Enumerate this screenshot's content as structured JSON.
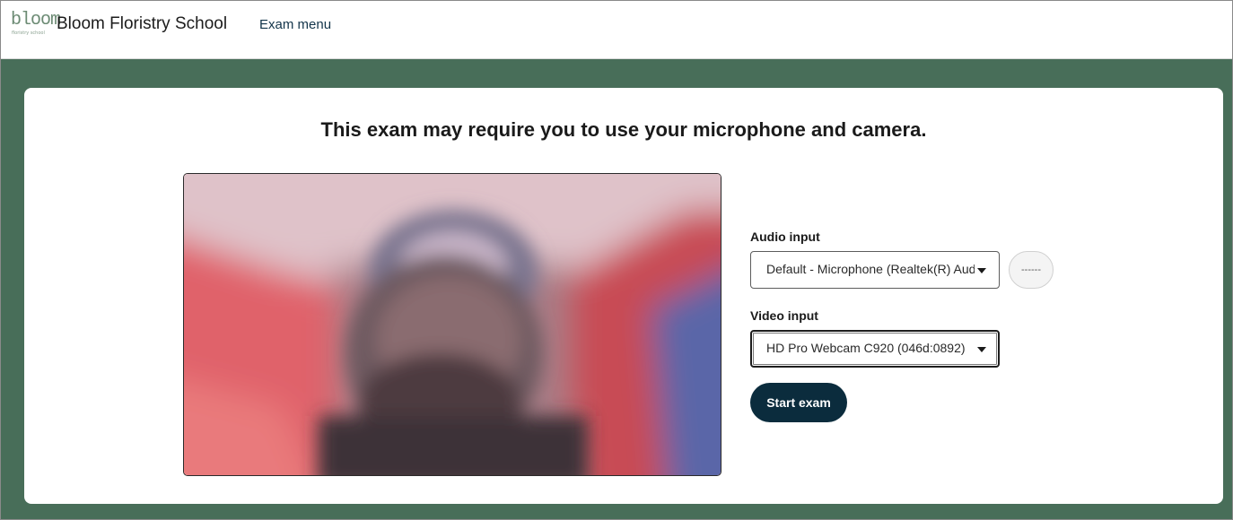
{
  "header": {
    "logo_word": "bloom",
    "logo_tagline": "floristry school",
    "school_name": "Bloom Floristry School",
    "nav_link": "Exam menu"
  },
  "main": {
    "heading": "This exam may require you to use your microphone and camera.",
    "audio": {
      "label": "Audio input",
      "selected": "Default - Microphone (Realtek(R) Audio)",
      "level_text": "------"
    },
    "video": {
      "label": "Video input",
      "selected": "HD Pro Webcam C920 (046d:0892)"
    },
    "start_button": "Start exam"
  },
  "colors": {
    "page_background": "#486e59",
    "brand_text": "#12344a",
    "primary_button": "#0b2c3d",
    "logo": "#6b8a73"
  },
  "icons": {
    "dropdown": "chevron-down-icon",
    "camera_preview": "blurred-webcam-feed"
  }
}
